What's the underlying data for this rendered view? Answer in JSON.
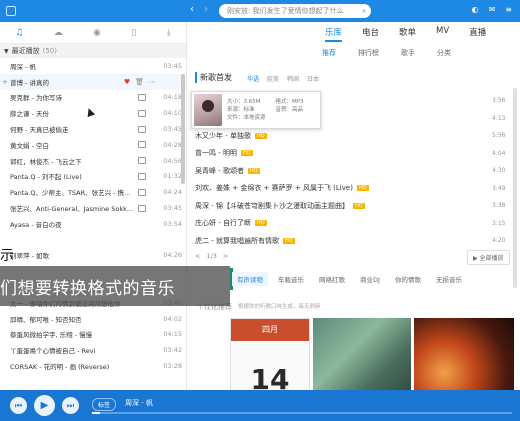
{
  "search": {
    "placeholder": "刚安放: 我们发生了爱情你想起了什么"
  },
  "left": {
    "tab_icons": [
      "music-note-icon",
      "cloud-icon",
      "radio-icon",
      "phone-icon",
      "download-icon"
    ],
    "section_title": "最近播放",
    "section_count": "(50)",
    "songs": [
      {
        "title": "周深 - 帆",
        "duration": "03:45",
        "mv": false
      },
      {
        "title": "曾博 - 讲真的",
        "duration": "",
        "mv": false,
        "selected": true
      },
      {
        "title": "吴克群 - 为你写诗",
        "duration": "04:18",
        "mv": true
      },
      {
        "title": "薛之谦 - 天份",
        "duration": "04:10",
        "mv": true
      },
      {
        "title": "何野 - 天真已被偷走",
        "duration": "03:45",
        "mv": true
      },
      {
        "title": "黄文娟 - 空白",
        "duration": "04:28",
        "mv": true
      },
      {
        "title": "郭红，林俊杰 - 飞云之下",
        "duration": "04:56",
        "mv": true
      },
      {
        "title": "Panta.Q - 刘不起 (Live)",
        "duration": "01:32",
        "mv": true
      },
      {
        "title": "Panta.Q、少帮主、TSAR、张艺兴 - 携...",
        "duration": "04:24",
        "mv": true
      },
      {
        "title": "张艺兴、Anti-General、Jasmine Sokk...",
        "duration": "03:45",
        "mv": true
      },
      {
        "title": "Ayasa - 音白の夜",
        "duration": "03:54",
        "mv": false
      },
      {
        "title": "",
        "duration": "",
        "mv": false
      },
      {
        "title": "刘翠萍 - 如歌",
        "duration": "04:26",
        "mv": false
      },
      {
        "title": "",
        "duration": "",
        "mv": false
      },
      {
        "title": "",
        "duration": "",
        "mv": false
      },
      {
        "title": "太一 - 像喂你们的情到被迫突然想他你",
        "duration": "03:45",
        "mv": false
      },
      {
        "title": "邱晴、郁可唯 - 知否知否",
        "duration": "04:02",
        "mv": false
      },
      {
        "title": "蔡蛋风微拍学字, 乐翔 - 慢慢",
        "duration": "04:15",
        "mv": false
      },
      {
        "title": "丫蛋蛋唤个心情被自己 - Revi",
        "duration": "03:42",
        "mv": false
      },
      {
        "title": "CORSAK - 花的明 - 画 (Reverse)",
        "duration": "03:28",
        "mv": false
      }
    ]
  },
  "right": {
    "nav_tabs": [
      "乐库",
      "电台",
      "歌单",
      "MV",
      "直播"
    ],
    "sub_tabs": [
      "推荐",
      "排行榜",
      "歌手",
      "分类"
    ],
    "new_song_title": "新歌首发",
    "regions": [
      "华语",
      "欧美",
      "韩国",
      "日本"
    ],
    "popup": {
      "size_label": "大小：",
      "size": "3.65M",
      "format_label": "格式：",
      "format": "MP3",
      "source_label": "来源：",
      "source": "标准",
      "quality_label": "音质：",
      "quality": "高品",
      "local_label": "文件：本地资源"
    },
    "new_songs": [
      {
        "title": "",
        "hq": false
      },
      {
        "title": "",
        "hq": false
      },
      {
        "title": "木又少年 - 单独歌",
        "hq": true
      },
      {
        "title": "曾一鸣 - 明明",
        "hq": true
      },
      {
        "title": "吴青峰 - 歌颂者",
        "hq": true
      },
      {
        "title": "刘欢、姜姝 + 金绵衣 + 赛萨罗 + 风属于飞 (Live)",
        "hq": true
      },
      {
        "title": "周深 - 锦【斗破苍穹剧集卜沙之漫取动画主题曲】",
        "hq": true
      },
      {
        "title": "庄心妍 - 自行了断",
        "hq": true
      },
      {
        "title": "虎二 - 就算我唱遍所有情歌",
        "hq": true
      }
    ],
    "durations": [
      "3:56",
      "4:13",
      "5:56",
      "4:04",
      "4:30",
      "3:49",
      "3:38",
      "3:15",
      "4:20"
    ],
    "pager": {
      "prev": "<",
      "page": "1/3",
      "next": ">"
    },
    "full_play": "全部播放",
    "categories": [
      "有声读物",
      "车载音乐",
      "网络红歌",
      "商业DJ",
      "你的情歌",
      "无损音乐"
    ],
    "recommend_title": "个性化推荐",
    "recommend_note": "根据你的听歌口味生成，每天刷新",
    "cover1": {
      "month": "四月",
      "day": "14"
    }
  },
  "overlay": {
    "caption_top": "示",
    "caption_main": "们想要转换格式的音乐"
  },
  "player": {
    "tag": "标签",
    "now_playing": "周深 - 帆",
    "progress": 0.02,
    "buttons": [
      "prev-icon",
      "play-icon",
      "next-icon"
    ]
  },
  "colors": {
    "accent": "#1e88e5",
    "player": "#1976d2",
    "hq": "#f5b400"
  }
}
